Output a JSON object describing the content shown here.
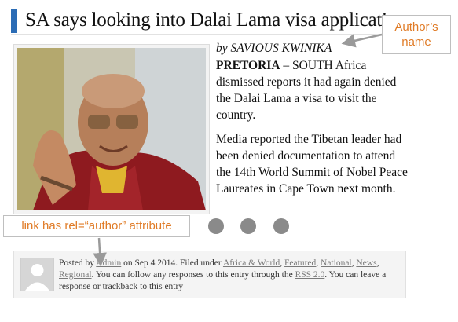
{
  "article": {
    "title": "SA says looking into Dalai Lama visa application",
    "byline": "by SAVIOUS KWINIKA",
    "dateline": "PRETORIA",
    "dash": " – ",
    "para1_rest": "SOUTH Africa dismissed reports it had again denied the Dalai Lama a visa to visit the country.",
    "para2": "Media reported the Tibetan leader had been denied documentation to attend the 14th World Summit of Nobel Peace Laureates in Cape Town next month."
  },
  "annotations": {
    "author_name": "Author’s name",
    "link_rel": "link has rel=“author” attribute"
  },
  "footer": {
    "posted_by": "Posted by ",
    "author_link": "Admin",
    "on_date": " on Sep 4 2014. Filed under ",
    "categories": [
      "Africa & World",
      "Featured",
      "National",
      "News",
      "Regional"
    ],
    "follow_text": ". You can follow any responses to this entry through the ",
    "rss_link": "RSS 2.0",
    "trailing": ". You can leave a response or trackback to this entry"
  },
  "colors": {
    "accent_bar": "#2b6cb5",
    "annotation_text": "#e07b26",
    "link": "#7a7a7a"
  },
  "icons": [
    "avatar-placeholder-icon",
    "arrow-annotation-icon"
  ]
}
